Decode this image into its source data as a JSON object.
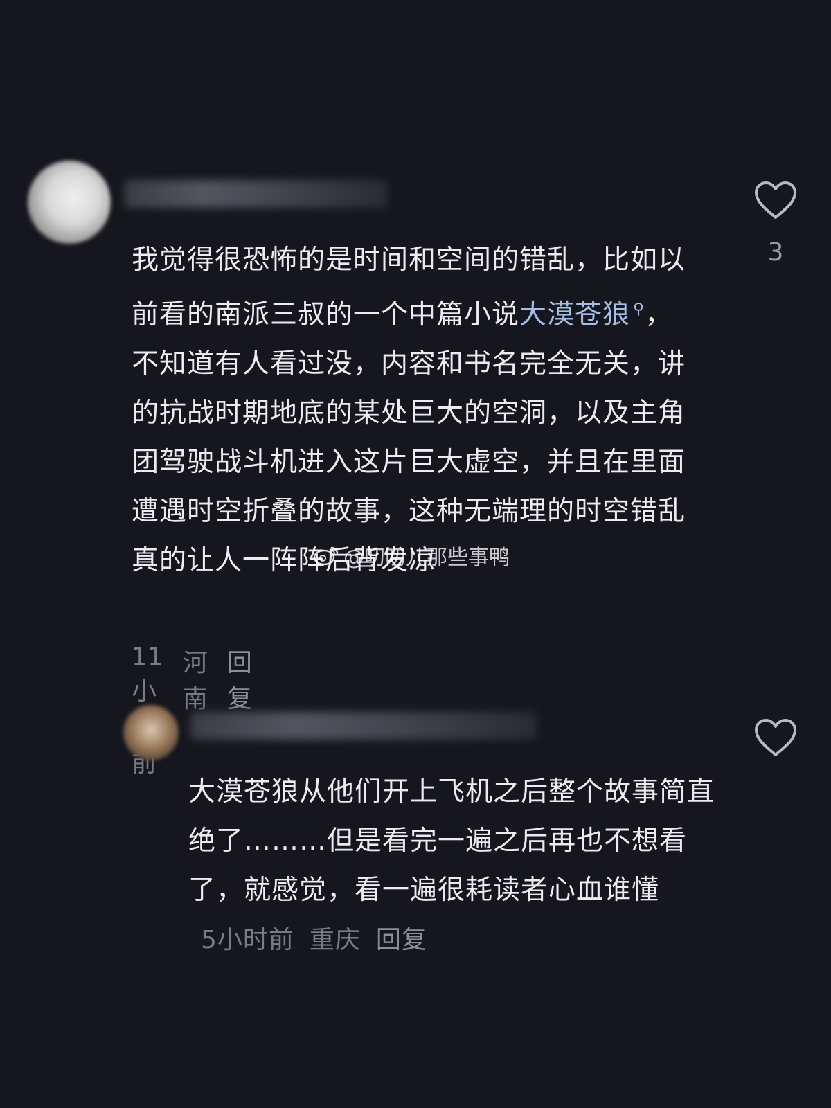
{
  "comments": [
    {
      "text_parts": [
        "我觉得很恐怖的是时间和空间的错乱，比如以前看的南派三叔的一个中篇小说",
        "大漠苍狼",
        "，不知道有人看过没，内容和书名完全无关，讲的抗战时期地底的某处巨大的空洞，以及主角团驾驶战斗机进入这片巨大虚空，并且在里面遭遇时空折叠的故事，这种无端理的时空错乱真的让人一阵阵后背发凉"
      ],
      "time": "11小时前",
      "location": "河南",
      "reply_label": "回复",
      "likes": "3"
    },
    {
      "text": "大漠苍狼从他们开上飞机之后整个故事简直绝了………但是看完一遍之后再也不想看了，就感觉，看一遍很耗读者心血谁懂",
      "time": "5小时前",
      "location": "重庆",
      "reply_label": "回复"
    }
  ],
  "watermark": "@叨叨儿那些事鸭"
}
